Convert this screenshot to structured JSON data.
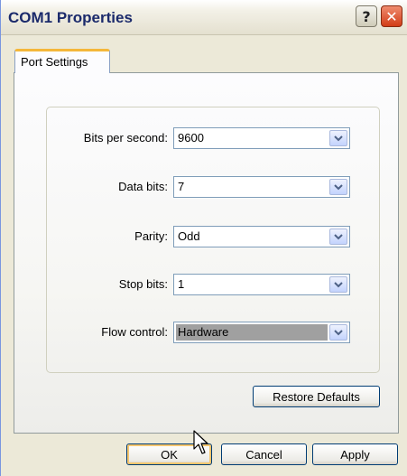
{
  "window": {
    "title": "COM1 Properties",
    "help_glyph": "?",
    "close_glyph": "✕"
  },
  "tabs": [
    {
      "label": "Port Settings",
      "selected": true
    }
  ],
  "fields": {
    "bits_per_second": {
      "label": "Bits per second:",
      "value": "9600"
    },
    "data_bits": {
      "label": "Data bits:",
      "value": "7"
    },
    "parity": {
      "label": "Parity:",
      "value": "Odd"
    },
    "stop_bits": {
      "label": "Stop bits:",
      "value": "1"
    },
    "flow_control": {
      "label": "Flow control:",
      "value": "Hardware",
      "highlighted": true
    }
  },
  "buttons": {
    "restore_defaults": "Restore Defaults",
    "ok": "OK",
    "cancel": "Cancel",
    "apply": "Apply"
  },
  "icons": {
    "dropdown": "chevron-down-icon",
    "help": "help-icon",
    "close": "close-icon",
    "cursor": "mouse-pointer-icon"
  },
  "colors": {
    "tab_accent": "#f4b73a",
    "close_button": "#d23c17",
    "title_text": "#1b2a6b"
  }
}
